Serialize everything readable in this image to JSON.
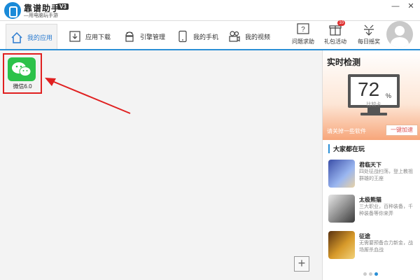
{
  "window": {
    "app_name": "靠谱助手",
    "version": "V3",
    "subtitle": "—用电脑玩手游",
    "minimize_label": "—",
    "close_label": "✕"
  },
  "nav": {
    "tabs": [
      {
        "label": "我的应用",
        "icon": "home-icon",
        "active": true
      },
      {
        "label": "应用下载",
        "icon": "download-icon",
        "active": false
      },
      {
        "label": "引擎管理",
        "icon": "android-icon",
        "active": false
      },
      {
        "label": "我的手机",
        "icon": "phone-icon",
        "active": false
      },
      {
        "label": "我的视频",
        "icon": "video-icon",
        "active": false
      }
    ],
    "right_items": [
      {
        "label": "问题求助",
        "icon": "help-icon"
      },
      {
        "label": "礼包活动",
        "icon": "gift-icon",
        "badge": "10"
      },
      {
        "label": "每日摇奖",
        "icon": "lottery-icon"
      }
    ]
  },
  "main": {
    "apps": [
      {
        "label": "微信6.0",
        "icon": "wechat-icon"
      }
    ],
    "add_label": "+"
  },
  "monitor": {
    "title": "实时检测",
    "score": "72",
    "unit": "%",
    "compare_label": "比较卡",
    "tip": "请关掉一些软件",
    "speed_button": "一键加速"
  },
  "games": {
    "section_title": "大家都在玩",
    "items": [
      {
        "name": "君临天下",
        "desc": "四处征战扫荡，登上教祖群雄的王座",
        "thumb_color": "#6a7fc9"
      },
      {
        "name": "太极熊猫",
        "desc": "三大职业，百种装备，千种装备等你来弄",
        "thumb_color": "#8a8a8a"
      },
      {
        "name": "征途",
        "desc": "无需要预备合力新金，战场厮杀血战",
        "thumb_color": "#c88a2a"
      }
    ],
    "page_dots": 3,
    "active_dot": 3
  },
  "colors": {
    "accent": "#2a8fd6",
    "highlight_red": "#e02020",
    "wechat_green": "#2cc24a",
    "monitor_orange": "#f7a67a"
  }
}
